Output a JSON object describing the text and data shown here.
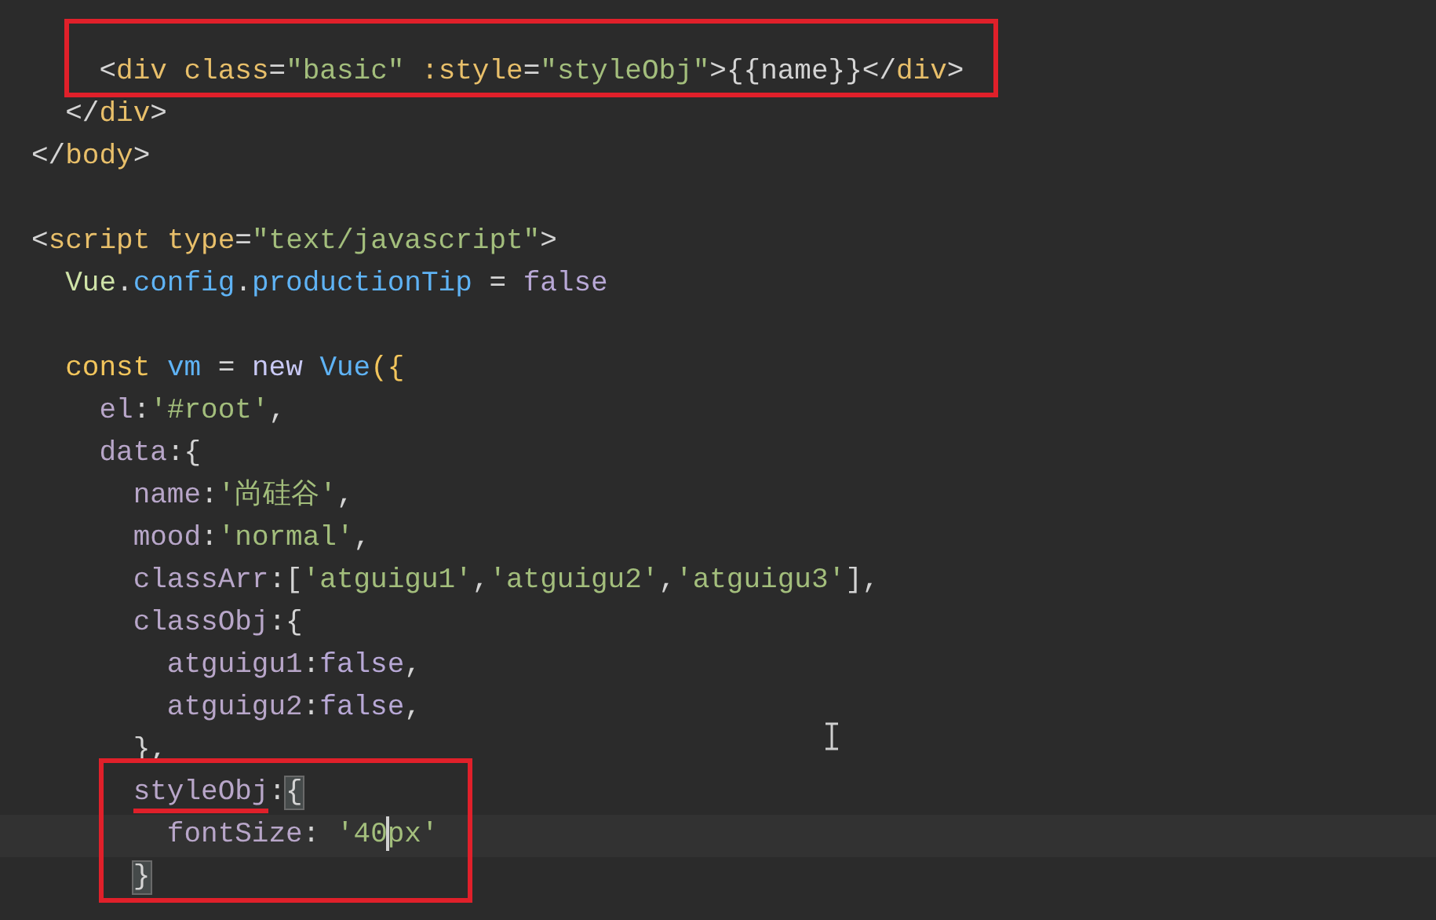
{
  "editor": {
    "lines": [
      {
        "kind": "blank",
        "boxed": true
      },
      {
        "kind": "code",
        "boxed": true,
        "tokens": [
          {
            "text": "    <",
            "kind": "punct"
          },
          {
            "text": "div",
            "kind": "tag"
          },
          {
            "text": "class",
            "kind": "attr",
            "gap_before": true
          },
          {
            "text": "=",
            "kind": "punct"
          },
          {
            "text": "\"basic\"",
            "kind": "string"
          },
          {
            "text": ":style",
            "kind": "attr",
            "gap_before": true
          },
          {
            "text": "=",
            "kind": "punct"
          },
          {
            "text": "\"styleObj\"",
            "kind": "string"
          },
          {
            "text": ">{{name}}</",
            "kind": "punct"
          },
          {
            "text": "div",
            "kind": "tag"
          },
          {
            "text": ">",
            "kind": "punct"
          }
        ]
      },
      {
        "kind": "code",
        "boxed": false,
        "tokens": [
          {
            "text": "  </",
            "kind": "punct"
          },
          {
            "text": "div",
            "kind": "tag"
          },
          {
            "text": ">",
            "kind": "punct"
          }
        ]
      },
      {
        "kind": "code",
        "boxed": false,
        "tokens": [
          {
            "text": "</",
            "kind": "punct"
          },
          {
            "text": "body",
            "kind": "tag"
          },
          {
            "text": ">",
            "kind": "punct"
          }
        ]
      },
      {
        "kind": "blank",
        "boxed": false
      },
      {
        "kind": "code",
        "boxed": false,
        "tokens": [
          {
            "text": "<",
            "kind": "punct"
          },
          {
            "text": "script",
            "kind": "tag"
          },
          {
            "text": "type",
            "kind": "attr",
            "gap_before": true
          },
          {
            "text": "=",
            "kind": "punct"
          },
          {
            "text": "\"text/javascript\"",
            "kind": "string"
          },
          {
            "text": ">",
            "kind": "punct"
          }
        ]
      },
      {
        "kind": "code",
        "boxed": false,
        "tokens": [
          {
            "text": "  Vue",
            "kind": "class"
          },
          {
            "text": ".",
            "kind": "punct"
          },
          {
            "text": "config",
            "kind": "prop"
          },
          {
            "text": ".",
            "kind": "punct"
          },
          {
            "text": "productionTip",
            "kind": "prop"
          },
          {
            "text": "=",
            "kind": "punct",
            "gap_before": true
          },
          {
            "text": "false",
            "kind": "literal",
            "gap_before": true
          }
        ]
      },
      {
        "kind": "blank",
        "boxed": false
      },
      {
        "kind": "code",
        "boxed": false,
        "tokens": [
          {
            "text": "  const",
            "kind": "keyword"
          },
          {
            "text": "vm",
            "kind": "prop",
            "gap_before": true
          },
          {
            "text": "=",
            "kind": "punct",
            "gap_before": true
          },
          {
            "text": "new",
            "kind": "new",
            "gap_before": true
          },
          {
            "text": "Vue",
            "kind": "prop",
            "gap_before": true
          },
          {
            "text": "({",
            "kind": "paren"
          }
        ]
      },
      {
        "kind": "code",
        "boxed": false,
        "tokens": [
          {
            "text": "    el",
            "kind": "key"
          },
          {
            "text": ":",
            "kind": "punct"
          },
          {
            "text": "'#root'",
            "kind": "string"
          },
          {
            "text": ",",
            "kind": "punct"
          }
        ]
      },
      {
        "kind": "code",
        "boxed": false,
        "tokens": [
          {
            "text": "    data",
            "kind": "key"
          },
          {
            "text": ":{",
            "kind": "punct"
          }
        ]
      },
      {
        "kind": "code",
        "boxed": false,
        "tokens": [
          {
            "text": "      name",
            "kind": "key"
          },
          {
            "text": ":",
            "kind": "punct"
          },
          {
            "text": "'尚硅谷'",
            "kind": "string"
          },
          {
            "text": ",",
            "kind": "punct"
          }
        ]
      },
      {
        "kind": "code",
        "boxed": false,
        "tokens": [
          {
            "text": "      mood",
            "kind": "key"
          },
          {
            "text": ":",
            "kind": "punct"
          },
          {
            "text": "'normal'",
            "kind": "string"
          },
          {
            "text": ",",
            "kind": "punct"
          }
        ]
      },
      {
        "kind": "code",
        "boxed": false,
        "tokens": [
          {
            "text": "      classArr",
            "kind": "key"
          },
          {
            "text": ":[",
            "kind": "punct"
          },
          {
            "text": "'atguigu1'",
            "kind": "string"
          },
          {
            "text": ",",
            "kind": "punct"
          },
          {
            "text": "'atguigu2'",
            "kind": "string"
          },
          {
            "text": ",",
            "kind": "punct"
          },
          {
            "text": "'atguigu3'",
            "kind": "string"
          },
          {
            "text": "],",
            "kind": "punct"
          }
        ]
      },
      {
        "kind": "code",
        "boxed": false,
        "tokens": [
          {
            "text": "      classObj",
            "kind": "key"
          },
          {
            "text": ":{",
            "kind": "punct"
          }
        ]
      },
      {
        "kind": "code",
        "boxed": false,
        "tokens": [
          {
            "text": "        atguigu1",
            "kind": "key"
          },
          {
            "text": ":",
            "kind": "punct"
          },
          {
            "text": "false",
            "kind": "literal"
          },
          {
            "text": ",",
            "kind": "punct"
          }
        ]
      },
      {
        "kind": "code",
        "boxed": false,
        "tokens": [
          {
            "text": "        atguigu2",
            "kind": "key"
          },
          {
            "text": ":",
            "kind": "punct"
          },
          {
            "text": "false",
            "kind": "literal"
          },
          {
            "text": ",",
            "kind": "punct"
          }
        ]
      },
      {
        "kind": "code",
        "boxed": false,
        "tokens": [
          {
            "text": "      },",
            "kind": "punct"
          }
        ]
      },
      {
        "kind": "code",
        "boxed": true,
        "tokens": [
          {
            "text": "      styleObj",
            "kind": "key",
            "underlined": true
          },
          {
            "text": ":",
            "kind": "punct"
          },
          {
            "text": "{",
            "kind": "punct",
            "matched": true
          }
        ]
      },
      {
        "kind": "code",
        "boxed": true,
        "current": true,
        "tokens": [
          {
            "text": "        fontSize",
            "kind": "key"
          },
          {
            "text": ":",
            "kind": "punct"
          },
          {
            "text": "'40",
            "kind": "string",
            "gap_before": true
          },
          {
            "kind": "cursor"
          },
          {
            "text": "px'",
            "kind": "string"
          }
        ]
      },
      {
        "kind": "code",
        "boxed": true,
        "tokens": [
          {
            "text": "      }",
            "kind": "punct",
            "matched": true
          }
        ]
      }
    ]
  }
}
